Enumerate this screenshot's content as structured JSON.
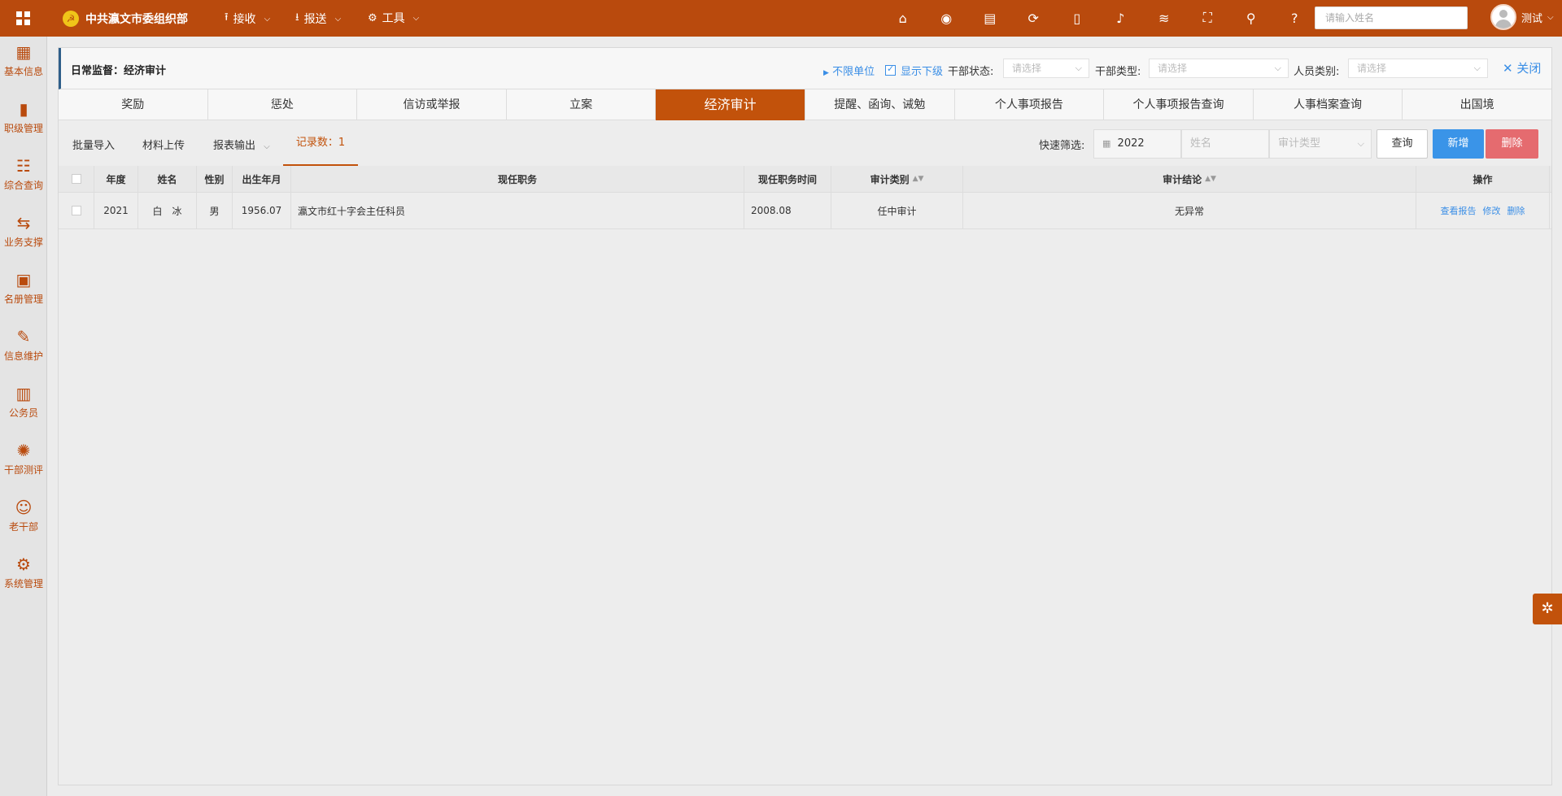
{
  "topbar": {
    "brand": "中共瀛文市委组织部",
    "menus": [
      {
        "label": "接收",
        "icon": "upload-icon"
      },
      {
        "label": "报送",
        "icon": "download-icon"
      },
      {
        "label": "工具",
        "icon": "gear-icon"
      }
    ],
    "icons": [
      "home-icon",
      "eye-icon",
      "book-icon",
      "refresh-icon",
      "mobile-icon",
      "bell-icon",
      "database-icon",
      "fullscreen-icon",
      "search-icon",
      "help-icon"
    ],
    "search_placeholder": "请输入姓名",
    "user_name": "测试"
  },
  "sidebar": {
    "items": [
      {
        "label": "基本信息",
        "icon": "grid-icon"
      },
      {
        "label": "职级管理",
        "icon": "book-icon"
      },
      {
        "label": "综合查询",
        "icon": "list-icon"
      },
      {
        "label": "业务支撑",
        "icon": "flow-icon"
      },
      {
        "label": "名册管理",
        "icon": "roster-icon"
      },
      {
        "label": "信息维护",
        "icon": "user-edit-icon"
      },
      {
        "label": "公务员",
        "icon": "clipboard-icon"
      },
      {
        "label": "干部测评",
        "icon": "settings-icon"
      },
      {
        "label": "老干部",
        "icon": "user-group-icon"
      },
      {
        "label": "系统管理",
        "icon": "system-icon"
      }
    ]
  },
  "header": {
    "title": "日常监督：经济审计",
    "unlimited_unit": "不限单位",
    "show_subordinate": "显示下级",
    "show_subordinate_checked": true,
    "filters": [
      {
        "label": "干部状态:",
        "placeholder": "请选择"
      },
      {
        "label": "干部类型:",
        "placeholder": "请选择"
      },
      {
        "label": "人员类别:",
        "placeholder": "请选择"
      }
    ],
    "close_label": "关闭"
  },
  "tabs": [
    "奖励",
    "惩处",
    "信访或举报",
    "立案",
    "经济审计",
    "提醒、函询、诫勉",
    "个人事项报告",
    "个人事项报告查询",
    "人事档案查询",
    "出国境"
  ],
  "active_tab": "经济审计",
  "toolbar": {
    "batch_import": "批量导入",
    "material_upload": "材料上传",
    "report_export": "报表输出",
    "record_count": "记录数：1",
    "quick_filter_label": "快速筛选:",
    "year_value": "2022",
    "name_placeholder": "姓名",
    "audit_type_placeholder": "审计类型",
    "query": "查询",
    "add": "新增",
    "delete": "删除"
  },
  "table": {
    "columns": [
      "年度",
      "姓名",
      "性别",
      "出生年月",
      "现任职务",
      "现任职务时间",
      "审计类别",
      "审计结论",
      "操作"
    ],
    "rows": [
      {
        "year": "2021",
        "name": "白　冰",
        "gender": "男",
        "birth": "1956.07",
        "position": "瀛文市红十字会主任科员",
        "position_time": "2008.08",
        "audit_type": "任中审计",
        "conclusion": "无异常",
        "ops": [
          "查看报告",
          "修改",
          "删除"
        ]
      }
    ]
  },
  "colors": {
    "brand": "#b94a0d",
    "accent_blue": "#3a94e8",
    "danger": "#e56b6f"
  }
}
